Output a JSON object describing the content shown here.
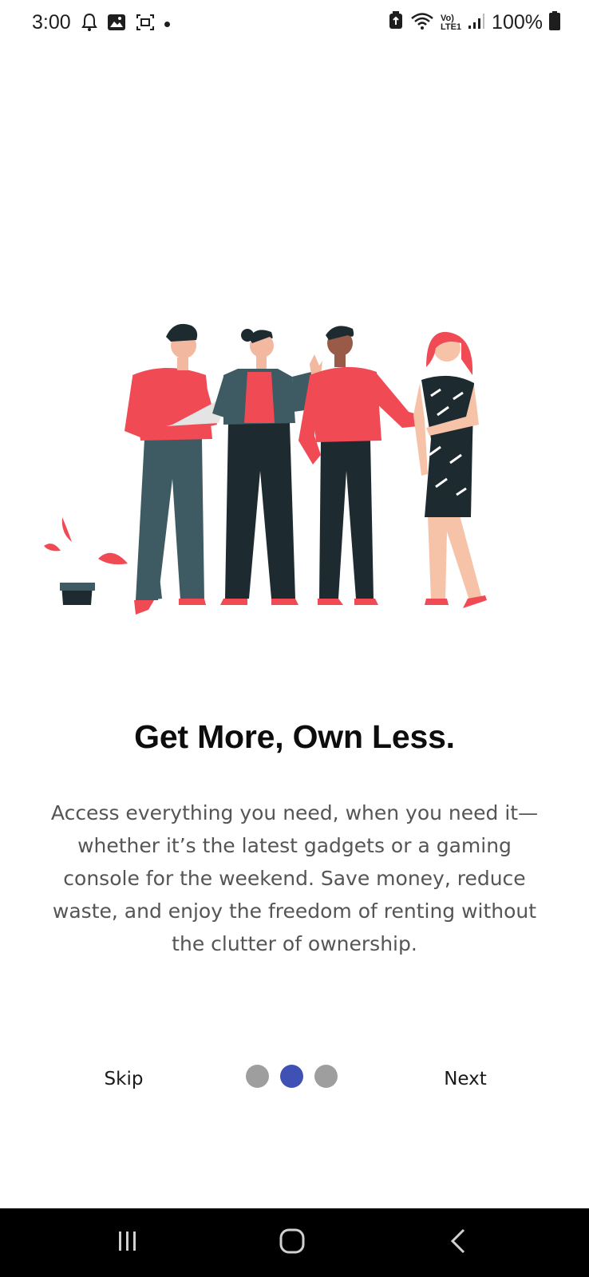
{
  "status_bar": {
    "time": "3:00",
    "battery": "100%",
    "icons": [
      "notification-bell-icon",
      "image-icon",
      "screenshot-icon",
      "dot-icon",
      "battery-saver-icon",
      "wifi-icon",
      "volte-icon",
      "signal-icon",
      "battery-icon"
    ],
    "volte_label": "Vo)",
    "lte_label": "LTE1"
  },
  "onboarding": {
    "title": "Get More, Own Less.",
    "description": "Access everything you need, when you need it—whether it’s the latest gadgets or a gaming console for the weekend. Save money, reduce waste, and enjoy the freedom of renting without the clutter of ownership.",
    "skip_label": "Skip",
    "next_label": "Next",
    "page_count": 3,
    "current_page": 2
  },
  "colors": {
    "accent": "#3f51b5",
    "dot_inactive": "#9e9e9e",
    "illustration_red": "#f04b55",
    "illustration_dark": "#1d2b30"
  },
  "nav_bar": {
    "icons": [
      "recent-apps-icon",
      "home-icon",
      "back-icon"
    ]
  }
}
